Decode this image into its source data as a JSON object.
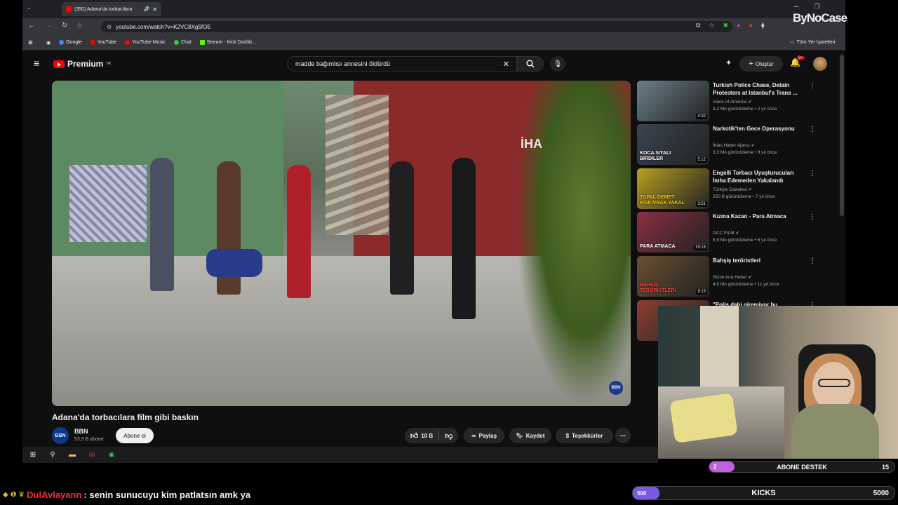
{
  "browser": {
    "tab_title": "(350) Adana'da torbacılara",
    "url": "youtube.com/watch?v=K2VC8Xg5fOE",
    "bookmarks": [
      "Google",
      "YouTube",
      "YouTube Music",
      "Chat",
      "Stream - Kick Dashb..."
    ],
    "all_bookmarks": "Tüm Yer İşaretleri"
  },
  "youtube": {
    "logo_text": "Premium",
    "logo_sup": "TR",
    "search_query": "madde bağımlısı annesini öldürdü",
    "create_label": "Oluştur",
    "notif_count": "9+"
  },
  "video": {
    "title": "Adana'da torbacılara film gibi baskın",
    "watermark": "İHA",
    "bbn_mark": "BBN",
    "channel": {
      "avatar": "BBN",
      "name": "BBN",
      "subs": "53,9 B abone",
      "subscribe_label": "Abone ol"
    },
    "likes": "10 B",
    "share_label": "Paylaş",
    "save_label": "Kaydet",
    "thanks_label": "Teşekkürler"
  },
  "recommendations": [
    {
      "title": "Turkish Police Chase, Detain Protesters at Istanbul's Trans ...",
      "channel": "Voice of America",
      "meta": "8,2 Mn görüntüleme • 2 yıl önce",
      "duration": "4:32",
      "color": "#6a7f8a"
    },
    {
      "title": "Narkotik'ten Gece Operasyonu",
      "channel": "İhlas Haber Ajansı",
      "meta": "3,3 Mn görüntüleme • 8 yıl önce",
      "duration": "5:12",
      "color": "#3a4450"
    },
    {
      "title": "Engelli Torbacı Uyuşturucuları İmha Edemeden Yakalandı",
      "channel": "Türkiye Gazetesi",
      "meta": "250 B görüntüleme • 7 yıl önce",
      "duration": "3:51",
      "color": "#b8a020"
    },
    {
      "title": "Kızma Kazan - Para Atmaca",
      "channel": "DCC FILM",
      "meta": "5,9 Mn görüntüleme • 6 yıl önce",
      "duration": "15:15",
      "color": "#8a3040"
    },
    {
      "title": "Bahşiş teröristleri",
      "channel": "Show Ana Haber",
      "meta": "4,5 Mn görüntüleme • 11 yıl önce",
      "duration": "9:15",
      "color": "#6a5030"
    },
    {
      "title": "\"Polis dahi giremiyor bu",
      "channel": "",
      "meta": "",
      "duration": "",
      "color": "#8a4030"
    }
  ],
  "thumb_captions": [
    "KOCA SIYALI BİRDİLER",
    "TOPAL DEMET KISKIVRAK YAKAL",
    "PARA ATMACA",
    "BAHŞİŞ TERÖRİSTLERİ"
  ],
  "overlays": {
    "streamer_logo": "ByNoCase",
    "goal1": {
      "label": "ABONE DESTEK",
      "current": "2",
      "target": "15",
      "progress": 0.133,
      "color": "#c060e0"
    },
    "goal2": {
      "label": "KICKS",
      "current": "500",
      "target": "5000",
      "progress": 0.1,
      "color": "#7a5ae0"
    },
    "chat": {
      "user": "DulAvlayann",
      "message": ": senin sunucuyu kim patlatsın amk ya"
    }
  }
}
